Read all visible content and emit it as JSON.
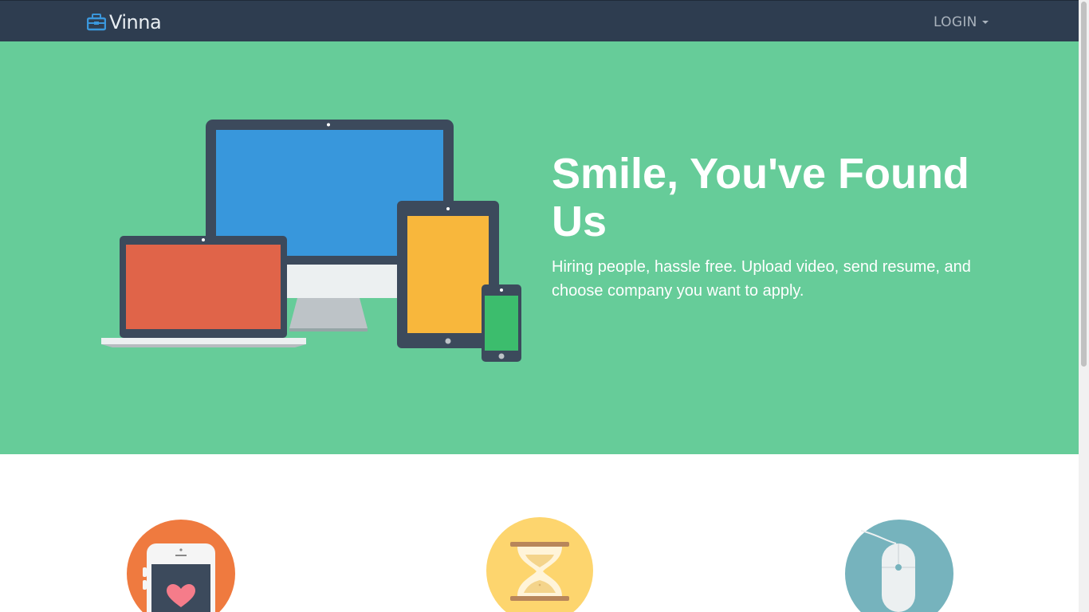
{
  "nav": {
    "brand": "Vinna",
    "login_label": "LOGIN",
    "brand_icon": "briefcase-icon",
    "login_icon": "caret-down-icon"
  },
  "hero": {
    "title": "Smile, You've Found Us",
    "subtitle": "Hiring people, hassle free. Upload video, send resume, and choose company you want to apply.",
    "illustration": "devices-illustration"
  },
  "features": [
    {
      "icon": "phone-heart-icon"
    },
    {
      "icon": "hourglass-icon"
    },
    {
      "icon": "mouse-icon"
    }
  ],
  "colors": {
    "navbar": "#2e3d50",
    "hero": "#66cc99",
    "brand_icon": "#3a97dc",
    "feature_orange": "#ef7a3f",
    "feature_yellow": "#fdd56e",
    "feature_teal": "#76b3bd"
  }
}
